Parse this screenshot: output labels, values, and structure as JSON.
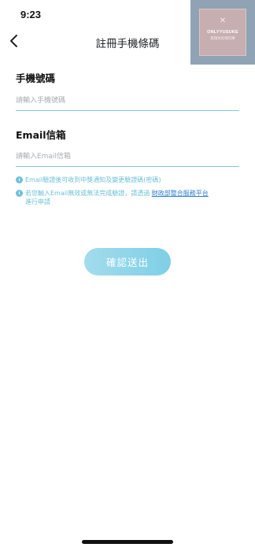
{
  "status_bar": {
    "time": "9:23"
  },
  "watermark": {
    "title": "ONLYYUSUKE",
    "subtitle": "悠翔找吃喝玩樂",
    "icon": "fork-knife-icon"
  },
  "nav": {
    "title": "註冊手機條碼",
    "back_icon": "chevron-left-icon"
  },
  "form": {
    "phone": {
      "label": "手機號碼",
      "placeholder": "請輸入手機號碼",
      "value": ""
    },
    "email": {
      "label": "Email信箱",
      "placeholder": "請輸入Email信箱",
      "value": ""
    }
  },
  "notes": [
    {
      "icon": "info-icon",
      "text": "Email驗證後可收到中獎通知及變更驗證碼(密碼)"
    },
    {
      "icon": "info-icon",
      "text_before": "若您輸入Email無效或無法完成驗證，請透過 ",
      "link": "財政部整合服務平台",
      "text_after": "進行申請"
    }
  ],
  "submit": {
    "label": "確認送出"
  },
  "colors": {
    "accent": "#6cc2d8",
    "button_start": "#a2dcec",
    "button_end": "#7fcfe6",
    "link": "#2e7fd0",
    "underline": "#7cc9dc"
  }
}
